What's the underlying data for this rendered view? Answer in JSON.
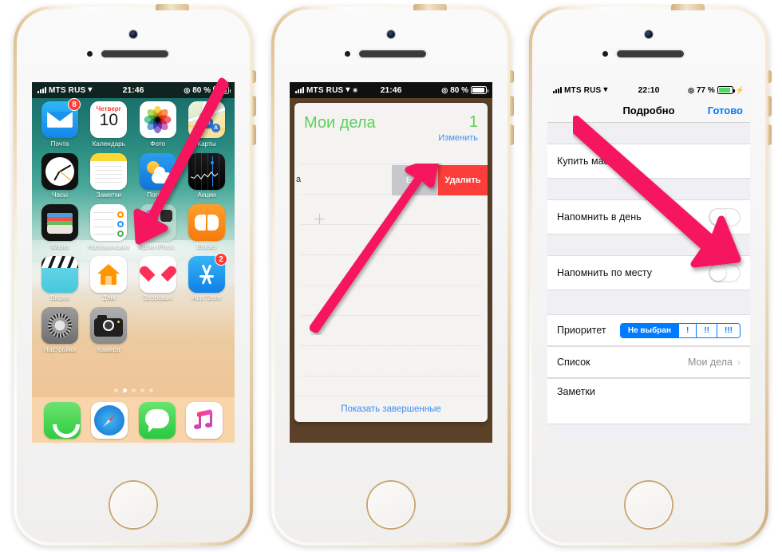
{
  "accent_pink": "#f5165f",
  "phone1": {
    "status": {
      "carrier": "MTS RUS",
      "time": "21:46",
      "battery_pct": "80 %",
      "wifi_icon": "wifi-icon",
      "signal_icon": "signal-bars-icon",
      "lock_icon": "rotation-lock-icon"
    },
    "apps_row1": [
      {
        "name": "Почта",
        "icon": "mail-icon",
        "badge": "8"
      },
      {
        "name": "Календарь",
        "icon": "calendar-icon",
        "weekday": "Четверг",
        "day": "10"
      },
      {
        "name": "Фото",
        "icon": "photos-icon"
      },
      {
        "name": "Карты",
        "icon": "maps-icon",
        "shield": "80",
        "pin": "A"
      }
    ],
    "apps_row2": [
      {
        "name": "Часы",
        "icon": "clock-icon"
      },
      {
        "name": "Заметки",
        "icon": "notes-icon"
      },
      {
        "name": "Погода",
        "icon": "weather-icon"
      },
      {
        "name": "Акции",
        "icon": "stocks-icon"
      }
    ],
    "apps_row3": [
      {
        "name": "Wallet",
        "icon": "wallet-icon"
      },
      {
        "name": "Напоминания",
        "icon": "reminders-icon"
      },
      {
        "name": "Apple-iPhon..",
        "icon": "folder-icon"
      },
      {
        "name": "iBooks",
        "icon": "ibooks-icon"
      }
    ],
    "apps_row4": [
      {
        "name": "Видео",
        "icon": "video-icon"
      },
      {
        "name": "Дом",
        "icon": "home-app-icon"
      },
      {
        "name": "Здоровье",
        "icon": "health-icon"
      },
      {
        "name": "App Store",
        "icon": "app-store-icon",
        "badge": "2"
      }
    ],
    "apps_row5": [
      {
        "name": "Настройки",
        "icon": "settings-icon"
      },
      {
        "name": "Камера",
        "icon": "camera-icon"
      }
    ],
    "dock": [
      {
        "name": "Телефон",
        "icon": "phone-icon"
      },
      {
        "name": "Safari",
        "icon": "safari-icon"
      },
      {
        "name": "Сообщения",
        "icon": "messages-icon"
      },
      {
        "name": "Музыка",
        "icon": "music-icon"
      }
    ],
    "page_dots": {
      "count": 5,
      "active_index": 1
    }
  },
  "phone2": {
    "status": {
      "carrier": "MTS RUS",
      "time": "21:46",
      "battery_pct": "80 %",
      "wifi_icon": "wifi-icon",
      "signal_icon": "signal-bars-icon",
      "brightness_icon": "brightness-icon",
      "lock_icon": "rotation-lock-icon"
    },
    "list_title": "Мои дела",
    "list_count": "1",
    "edit_label": "Изменить",
    "swiped_row_text": "а",
    "more_button": "Еще",
    "delete_button": "Удалить",
    "add_icon": "plus-icon",
    "show_completed": "Показать завершенные"
  },
  "phone3": {
    "status": {
      "carrier": "MTS RUS",
      "time": "22:10",
      "battery_pct": "77 %",
      "wifi_icon": "wifi-icon",
      "signal_icon": "signal-bars-icon",
      "charging_icon": "lightning-bolt-icon",
      "lock_icon": "rotation-lock-icon"
    },
    "nav_title": "Подробно",
    "nav_done": "Готово",
    "task_title": "Купить масло",
    "remind_day_label": "Напомнить в день",
    "remind_day_on": false,
    "remind_place_label": "Напомнить по месту",
    "remind_place_on": false,
    "priority_label": "Приоритет",
    "priority_options": [
      "Не выбран",
      "!",
      "!!",
      "!!!"
    ],
    "priority_selected_index": 0,
    "list_label": "Список",
    "list_value": "Мои дела",
    "notes_label": "Заметки",
    "chevron_icon": "chevron-right-icon"
  }
}
